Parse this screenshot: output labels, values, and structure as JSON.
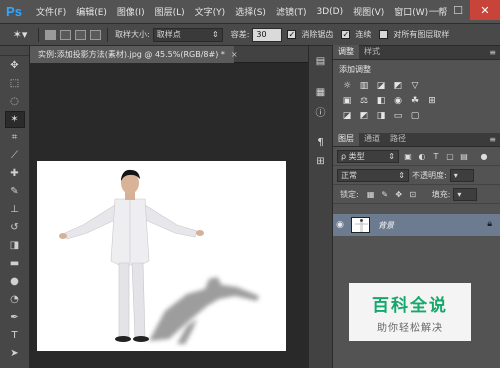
{
  "app": {
    "logo": "Ps"
  },
  "menu": [
    "文件(F)",
    "编辑(E)",
    "图像(I)",
    "图层(L)",
    "文字(Y)",
    "选择(S)",
    "滤镜(T)",
    "3D(D)",
    "视图(V)",
    "窗口(W)",
    "帮"
  ],
  "window_controls": {
    "minimize": "—",
    "maximize": "☐",
    "close": "✕"
  },
  "options": {
    "sample_size_label": "取样大小:",
    "sample_size_value": "取样点",
    "tolerance_label": "容差:",
    "tolerance_value": "30",
    "antialias_label": "消除锯齿",
    "contiguous_label": "连续",
    "sample_all_label": "对所有图层取样"
  },
  "document": {
    "tab_title": "实例:添加投影方法(素材).jpg @ 45.5%(RGB/8#) *",
    "close": "×"
  },
  "panels": {
    "adjust_tabs": [
      "调整",
      "样式"
    ],
    "adjust_title": "添加调整",
    "layers_tabs": [
      "图层",
      "通道",
      "路径"
    ],
    "kind_label": "ρ 类型",
    "blend_mode": "正常",
    "opacity_label": "不透明度:",
    "lock_label": "锁定:",
    "fill_label": "填充:",
    "layer_name": "背景"
  },
  "watermark": {
    "main": "百科全说",
    "sub": "助你轻松解决"
  },
  "colors": {
    "menubar": "#535353",
    "panel": "#535353",
    "canvas": "#ffffff",
    "selected_layer": "#6c7b8f",
    "watermark_green": "#14a86a"
  }
}
